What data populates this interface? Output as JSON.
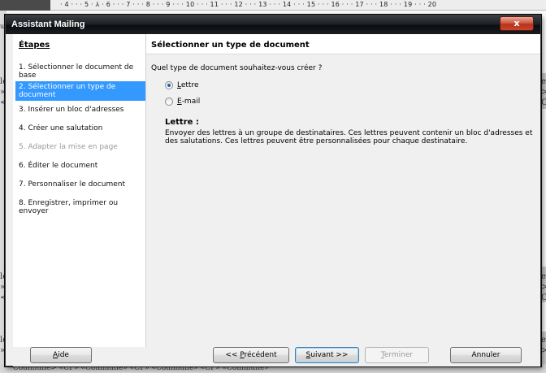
{
  "background": {
    "ruler_text": "· 4 · · · 5 · ⅄ · 6 · · · 7 · · · 8 · · · 9 · · · 10 · · · 11 · · · 12 · · · 13 · · · 14 · · · 15 · · · 16 · · · 17 · · · 18 · · · 19 · · · 20",
    "left_fragments": [
      "uel",
      "lè",
      "»1",
      "<c",
      "lè",
      "»1",
      "<c",
      "lè",
      "»1"
    ],
    "right_fragments": [
      "eve",
      ">",
      "Co",
      "eve",
      ">",
      "Co",
      "eve",
      ">"
    ],
    "bottom_text": "Commune>   «CP» «Commune»   «CP» «Commune»   «CP» «Commune»"
  },
  "dialog": {
    "title": "Assistant Mailing",
    "close_label": "x"
  },
  "sidebar": {
    "heading": "Étapes",
    "steps": [
      {
        "label": "1. Sélectionner le document de base",
        "state": "normal"
      },
      {
        "label": "2. Sélectionner un type de document",
        "state": "selected"
      },
      {
        "label": "3. Insérer un bloc d'adresses",
        "state": "normal"
      },
      {
        "label": "4. Créer une salutation",
        "state": "normal"
      },
      {
        "label": "5. Adapter la mise en page",
        "state": "disabled"
      },
      {
        "label": "6. Éditer le document",
        "state": "normal"
      },
      {
        "label": "7. Personnaliser le document",
        "state": "normal"
      },
      {
        "label": "8. Enregistrer, imprimer ou envoyer",
        "state": "normal"
      }
    ]
  },
  "main": {
    "header": "Sélectionner un type de document",
    "question": "Quel type de document souhaitez-vous créer ?",
    "options": [
      {
        "label": "Lettre",
        "selected": true
      },
      {
        "label": "E-mail",
        "selected": false
      }
    ],
    "desc_title": "Lettre :",
    "desc_text": "Envoyer des lettres à un groupe de destinataires. Ces lettres peuvent contenir un bloc d'adresses et des salutations. Ces lettres peuvent être personnalisées pour chaque destinataire."
  },
  "buttons": {
    "help": "Aide",
    "previous": "<< Précédent",
    "next": "Suivant >>",
    "finish": "Terminer",
    "cancel": "Annuler"
  },
  "colors": {
    "selection": "#3399ff",
    "dialog_bg": "#f0f0f0",
    "titlebar": "#1e2226",
    "close_button": "#c8462c"
  }
}
